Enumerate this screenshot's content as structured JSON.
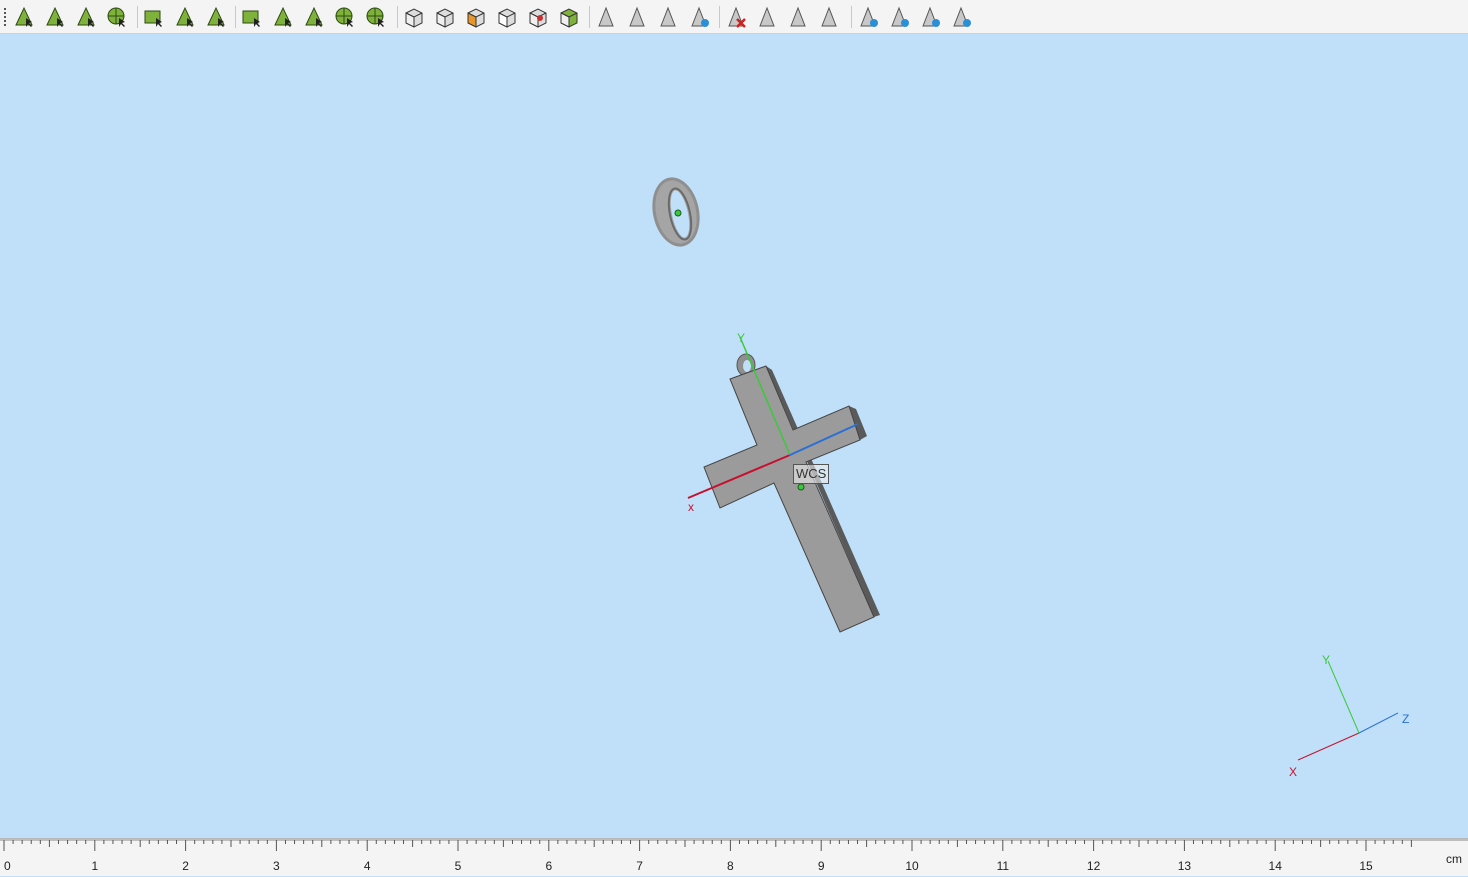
{
  "toolbar": {
    "groups": [
      [
        "select-edge-icon",
        "select-face-icon",
        "select-curve-icon",
        "select-circle-icon"
      ],
      [
        "select-rect-icon",
        "select-blob-icon",
        "select-spline-icon"
      ],
      [
        "select-mesh-icon",
        "select-vertex-icon",
        "select-cluster-icon",
        "select-wheel-icon",
        "select-sphere-icon"
      ],
      [
        "box-view-icon",
        "box-shaded-icon",
        "box-color-icon",
        "box-wire-icon",
        "box-material-icon",
        "box-texture-icon"
      ],
      [
        "arrow-light-icon",
        "arrow-plane-icon",
        "arrow-shade-icon",
        "arrow-globe-icon"
      ],
      [
        "delete-light-icon",
        "layer-plane-icon",
        "layer-copy-icon",
        "layer-shade-icon"
      ],
      [
        "eye-light-icon",
        "eye-scan-icon",
        "eye-point-icon",
        "eye-hide-icon"
      ]
    ]
  },
  "viewport": {
    "wcs_label": "WCS",
    "model_axes": {
      "x": "x",
      "y": "Y"
    },
    "orientation_gizmo": {
      "x": "X",
      "y": "Y",
      "z": "Z"
    }
  },
  "ruler": {
    "ticks": [
      "0",
      "1",
      "2",
      "3",
      "4",
      "5",
      "6",
      "7",
      "8",
      "9",
      "10",
      "11",
      "12",
      "13",
      "14",
      "15"
    ],
    "unit": "cm"
  },
  "colors": {
    "background": "#bfe0f8",
    "x_axis": "#c8102e",
    "y_axis": "#3cc83c",
    "z_axis": "#2a6fd6",
    "model_gray": "#9b9b9b"
  }
}
